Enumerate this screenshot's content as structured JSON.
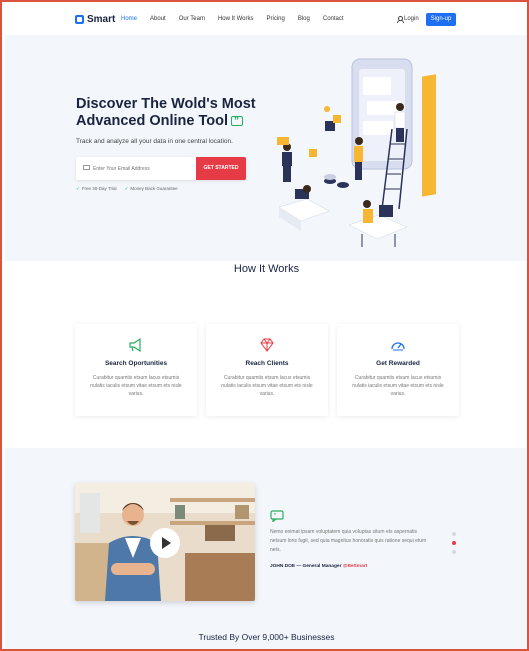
{
  "nav": {
    "logo": "Smart",
    "items": [
      {
        "label": "Home",
        "active": true
      },
      {
        "label": "About",
        "active": false
      },
      {
        "label": "Our Team",
        "active": false
      },
      {
        "label": "How It Works",
        "active": false
      },
      {
        "label": "Pricing",
        "active": false
      },
      {
        "label": "Blog",
        "active": false
      },
      {
        "label": "Contact",
        "active": false
      }
    ],
    "login_label": "Login",
    "signup_label": "Sign-up"
  },
  "hero": {
    "title_line1": "Discover The Wold's Most",
    "title_line2": "Advanced Online Tool",
    "subtitle": "Track and analyze all your data in one central location.",
    "email_placeholder": "Enter Your Email Address",
    "cta_label": "GET STARTED",
    "check1": "Free 30-Day Trial",
    "check2": "Money Back Guarantee"
  },
  "how_it_works": {
    "title": "How It Works",
    "cards": [
      {
        "icon": "megaphone-icon",
        "title": "Search Oportunities",
        "body": "Curabitur quamtis etsum lacus etsumis nulatis iaculis etsum vitae etsum ets nisle varius."
      },
      {
        "icon": "diamond-icon",
        "title": "Reach Clients",
        "body": "Curabitur quamtis etsum lacus etsumis nulatis iaculis etsum vitae etsum ets nisle varius."
      },
      {
        "icon": "speedometer-icon",
        "title": "Get Rewarded",
        "body": "Curabitur quamtis etsum lacus etsumis nulatis iaculis etsum vitae etsum ets nisle varius."
      }
    ]
  },
  "testimonial": {
    "text": "Nemo enimat ipsam voluptatem quia voluptas situm ets aspernatis netsum loris fugit, sed quia magnitus honoratis quis ratione sequi etum nets.",
    "author": "JOHN DOE — General Manager",
    "brand": "@BeSmart",
    "trusted": "Trusted By Over 9,000+ Businesses"
  },
  "colors": {
    "primary": "#1e6ff1",
    "accent": "#e63a46",
    "green": "#27ae60",
    "heading": "#1a2340"
  }
}
